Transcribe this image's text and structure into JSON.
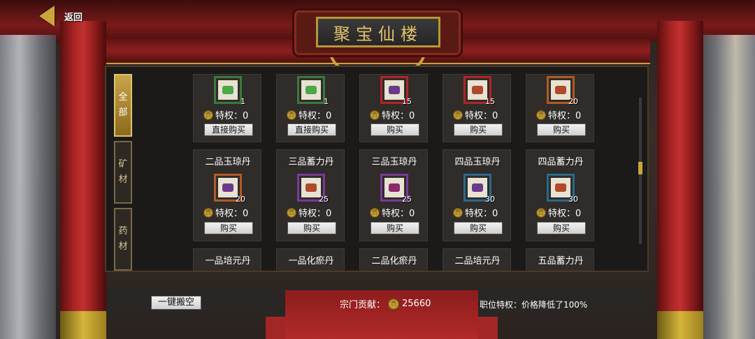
{
  "header": {
    "back_label": "返回",
    "shop_title": "聚宝仙楼"
  },
  "tabs": [
    {
      "label": "全部",
      "active": true
    },
    {
      "label": "矿材",
      "active": false
    },
    {
      "label": "药材",
      "active": false
    }
  ],
  "coin_glyph": "贡",
  "rows": [
    {
      "names": [
        "",
        "",
        "",
        "",
        ""
      ],
      "items": [
        {
          "qty": "1",
          "privilege": "特权：0",
          "button": "直接购买",
          "frame": "#3a7a3a",
          "gem": "#4aa84a"
        },
        {
          "qty": "1",
          "privilege": "特权：0",
          "button": "直接购买",
          "frame": "#3a7a3a",
          "gem": "#4aa84a"
        },
        {
          "qty": "15",
          "privilege": "特权：0",
          "button": "购买",
          "frame": "#b22424",
          "gem": "#6a3a8a"
        },
        {
          "qty": "15",
          "privilege": "特权：0",
          "button": "购买",
          "frame": "#b22424",
          "gem": "#b04a2a"
        },
        {
          "qty": "20",
          "privilege": "特权：0",
          "button": "购买",
          "frame": "#b25a24",
          "gem": "#b04a2a"
        }
      ]
    },
    {
      "names": [
        "二品玉琼丹",
        "三品蓄力丹",
        "三品玉琼丹",
        "四品玉琼丹",
        "四品蓄力丹"
      ],
      "items": [
        {
          "qty": "20",
          "privilege": "特权：0",
          "button": "购买",
          "frame": "#b25a24",
          "gem": "#6a3a8a"
        },
        {
          "qty": "25",
          "privilege": "特权：0",
          "button": "购买",
          "frame": "#7a3a9a",
          "gem": "#b04a2a"
        },
        {
          "qty": "25",
          "privilege": "特权：0",
          "button": "购买",
          "frame": "#7a3a9a",
          "gem": "#8a2a6a"
        },
        {
          "qty": "30",
          "privilege": "特权：0",
          "button": "购买",
          "frame": "#2a6a8a",
          "gem": "#6a3a8a"
        },
        {
          "qty": "30",
          "privilege": "特权：0",
          "button": "购买",
          "frame": "#2a6a8a",
          "gem": "#b04a2a"
        }
      ]
    },
    {
      "names": [
        "一品培元丹",
        "一品化瘀丹",
        "二品化瘀丹",
        "二品培元丹",
        "五品蓄力丹"
      ],
      "items": []
    }
  ],
  "footer": {
    "empty_button": "一键搬空",
    "contribution_label": "宗门贡献：",
    "contribution_value": "25660",
    "perk_text": "职位特权：价格降低了100%"
  }
}
